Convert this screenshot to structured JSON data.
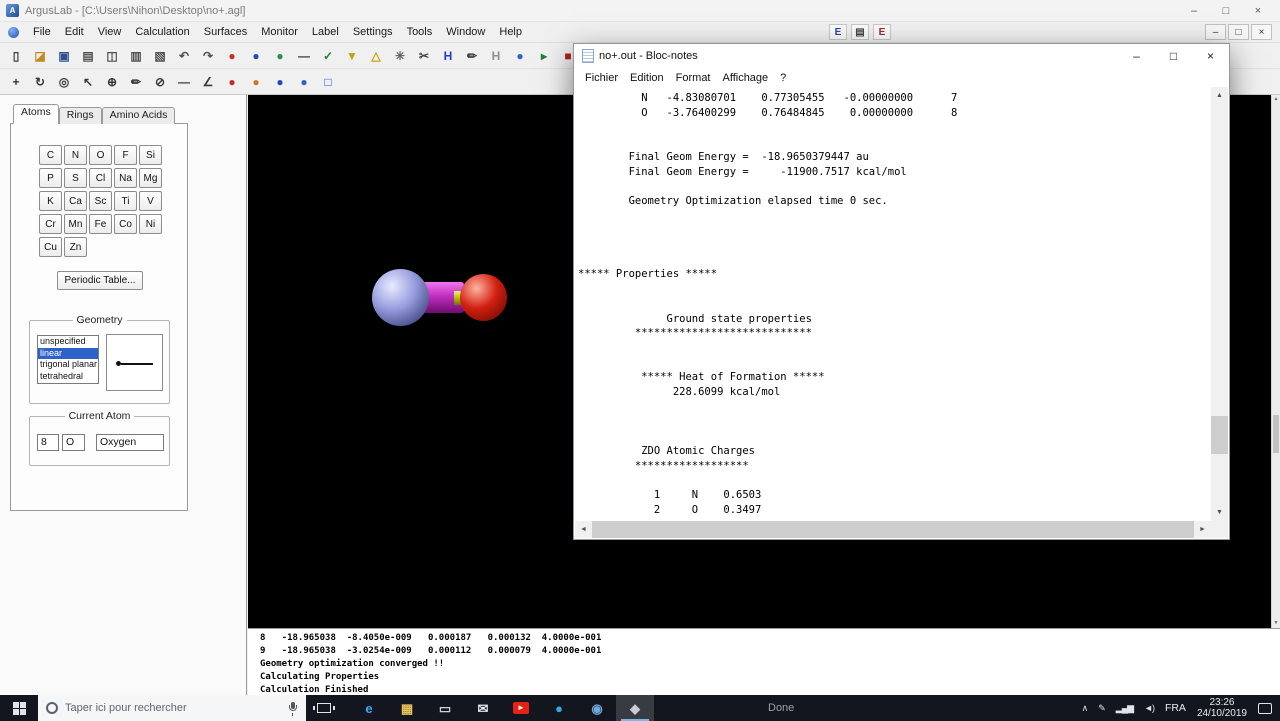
{
  "colors": {
    "selection": "#2f62c8",
    "taskbar-bg": "#14161f",
    "accent-underline": "#79b7e8",
    "mol-n": "#989ede",
    "mol-bond": "#c22ec2",
    "mol-bond2": "#c2c20e",
    "mol-o": "#d22010"
  },
  "arguslab": {
    "title": "ArgusLab - [C:\\Users\\Nihon\\Desktop\\no+.agl]",
    "app_icon_letter": "A",
    "window_controls": [
      {
        "name": "arguslab-minimize-button",
        "glyph": "–"
      },
      {
        "name": "arguslab-maximize-button",
        "glyph": "□"
      },
      {
        "name": "arguslab-close-button",
        "glyph": "×"
      }
    ],
    "menu": [
      "File",
      "Edit",
      "View",
      "Calculation",
      "Surfaces",
      "Monitor",
      "Label",
      "Settings",
      "Tools",
      "Window",
      "Help"
    ],
    "menubar_tools": [
      {
        "name": "energy-icon",
        "glyph": "E",
        "color": "#2a4a9a"
      },
      {
        "name": "output-table-icon",
        "glyph": "▤",
        "color": "#444444"
      },
      {
        "name": "energy-plot-icon",
        "glyph": "E",
        "color": "#9a2a2a"
      }
    ],
    "mdi_controls": [
      {
        "name": "mdi-minimize-button",
        "glyph": "–"
      },
      {
        "name": "mdi-restore-button",
        "glyph": "□"
      },
      {
        "name": "mdi-close-button",
        "glyph": "×"
      }
    ],
    "toolbar_main": [
      {
        "name": "new-file-icon",
        "glyph": "▯",
        "color": "#404040"
      },
      {
        "name": "open-folder-icon",
        "glyph": "◪",
        "color": "#c08a28"
      },
      {
        "name": "save-icon",
        "glyph": "▣",
        "color": "#30508c"
      },
      {
        "name": "print-icon",
        "glyph": "▤",
        "color": "#505050"
      },
      {
        "name": "capture-icon",
        "glyph": "◫",
        "color": "#505050"
      },
      {
        "name": "copy-icon",
        "glyph": "▥",
        "color": "#505050"
      },
      {
        "name": "paste-icon",
        "glyph": "▧",
        "color": "#505050"
      },
      {
        "name": "undo-icon",
        "glyph": "↶",
        "color": "#505050"
      },
      {
        "name": "redo-icon",
        "glyph": "↷",
        "color": "#505050"
      },
      {
        "name": "atom-red-icon",
        "glyph": "●",
        "color": "#c03028"
      },
      {
        "name": "atom-blue-icon",
        "glyph": "●",
        "color": "#2848b8"
      },
      {
        "name": "atom-green-icon",
        "glyph": "●",
        "color": "#289048"
      },
      {
        "name": "bond-tool-icon",
        "glyph": "―",
        "color": "#303030"
      },
      {
        "name": "clean-geometry-icon",
        "glyph": "✓",
        "color": "#208030"
      },
      {
        "name": "minimize-energy-icon",
        "glyph": "▼",
        "color": "#c8a000"
      },
      {
        "name": "measure-tool-icon",
        "glyph": "△",
        "color": "#c8a000"
      },
      {
        "name": "settings-gear-icon",
        "glyph": "✳",
        "color": "#606060"
      },
      {
        "name": "scissors-icon",
        "glyph": "✂",
        "color": "#404040"
      },
      {
        "name": "add-hydrogens-icon",
        "glyph": "H",
        "color": "#2040c0"
      },
      {
        "name": "pencil-icon",
        "glyph": "✏",
        "color": "#404040"
      },
      {
        "name": "remove-hydrogens-icon",
        "glyph": "H",
        "color": "#909090"
      },
      {
        "name": "sphere-display-icon",
        "glyph": "●",
        "color": "#3060d0"
      },
      {
        "name": "run-calculation-icon",
        "glyph": "▸",
        "color": "#208030"
      },
      {
        "name": "stop-calculation-icon",
        "glyph": "■",
        "color": "#b02020"
      }
    ],
    "toolbar_tools": [
      {
        "name": "pan-tool-icon",
        "glyph": "+",
        "color": "#383838"
      },
      {
        "name": "rotate-tool-icon",
        "glyph": "↻",
        "color": "#383838"
      },
      {
        "name": "zoom-tool-icon",
        "glyph": "◎",
        "color": "#383838"
      },
      {
        "name": "select-tool-icon",
        "glyph": "↖",
        "color": "#383838"
      },
      {
        "name": "center-tool-icon",
        "glyph": "⊕",
        "color": "#383838"
      },
      {
        "name": "draw-tool-icon",
        "glyph": "✏",
        "color": "#383838"
      },
      {
        "name": "erase-tool-icon",
        "glyph": "⊘",
        "color": "#383838"
      },
      {
        "name": "bond-line-icon",
        "glyph": "―",
        "color": "#383838"
      },
      {
        "name": "angle-tool-icon",
        "glyph": "∠",
        "color": "#383838"
      },
      {
        "name": "atom-color-red-icon",
        "glyph": "●",
        "color": "#c03028"
      },
      {
        "name": "atom-color-orange-icon",
        "glyph": "●",
        "color": "#d07820"
      },
      {
        "name": "atom-color-blue-icon",
        "glyph": "●",
        "color": "#2848b8"
      },
      {
        "name": "atom-color-navy-icon",
        "glyph": "●",
        "color": "#3060d0"
      },
      {
        "name": "selection-box-icon",
        "glyph": "□",
        "color": "#2858c8"
      }
    ],
    "left_panel": {
      "tabs": [
        {
          "label": "Atoms",
          "selected": true
        },
        {
          "label": "Rings"
        },
        {
          "label": "Amino Acids"
        }
      ],
      "elements": [
        "C",
        "N",
        "O",
        "F",
        "Si",
        "P",
        "S",
        "Cl",
        "Na",
        "Mg",
        "K",
        "Ca",
        "Sc",
        "Ti",
        "V",
        "Cr",
        "Mn",
        "Fe",
        "Co",
        "Ni",
        "Cu",
        "Zn"
      ],
      "periodic_table_label": "Periodic Table...",
      "geometry": {
        "label": "Geometry",
        "options": [
          {
            "label": "unspecified"
          },
          {
            "label": "linear",
            "selected": true
          },
          {
            "label": "trigonal planar"
          },
          {
            "label": "tetrahedral"
          }
        ]
      },
      "current_atom": {
        "label": "Current Atom",
        "atomic_number": "8",
        "symbol": "O",
        "element_name": "Oxygen"
      }
    },
    "scrollbar": {
      "up": "▲",
      "down": "▼"
    },
    "log_lines": [
      "8   -18.965038  -8.4050e-009   0.000187   0.000132  4.0000e-001",
      "9   -18.965038  -3.0254e-009   0.000112   0.000079  4.0000e-001",
      "Geometry optimization converged !!",
      "Calculating Properties",
      "Calculation Finished"
    ]
  },
  "notepad": {
    "title": "no+.out - Bloc-notes",
    "window_controls": [
      {
        "name": "notepad-minimize-button",
        "glyph": "–"
      },
      {
        "name": "notepad-maximize-button",
        "glyph": "□"
      },
      {
        "name": "notepad-close-button",
        "glyph": "×"
      }
    ],
    "menu": [
      "Fichier",
      "Edition",
      "Format",
      "Affichage",
      "?"
    ],
    "content_lines": [
      "          N   -4.83080701    0.77305455   -0.00000000      7",
      "          O   -3.76400299    0.76484845    0.00000000      8",
      "",
      "",
      "        Final Geom Energy =  -18.9650379447 au",
      "        Final Geom Energy =     -11900.7517 kcal/mol",
      "",
      "        Geometry Optimization elapsed time 0 sec.",
      "",
      "",
      "",
      "",
      "***** Properties *****",
      "",
      "",
      "              Ground state properties",
      "         ****************************",
      "",
      "",
      "          ***** Heat of Formation *****",
      "               228.6099 kcal/mol",
      "",
      "",
      "",
      "          ZDO Atomic Charges",
      "         ******************",
      "",
      "            1     N    0.6503",
      "            2     O    0.3497"
    ],
    "scrollbar": {
      "up": "▲",
      "down": "▼",
      "left": "◄",
      "right": "►"
    }
  },
  "taskbar": {
    "search_placeholder": "Taper ici pour rechercher",
    "status_text": "Done",
    "apps": [
      {
        "name": "edge-icon",
        "glyph": "e",
        "color": "#3fa9f5"
      },
      {
        "name": "file-explorer-icon",
        "glyph": "▦",
        "color": "#e8c25a"
      },
      {
        "name": "store-icon",
        "glyph": "▭",
        "color": "#cdd3da"
      },
      {
        "name": "mail-icon",
        "glyph": "✉",
        "color": "#e4e7ec"
      },
      {
        "name": "youtube-icon",
        "glyph": "►",
        "color": "#ffffff",
        "bg": "#e62117"
      },
      {
        "name": "telegram-icon",
        "glyph": "●",
        "color": "#2fa8e0"
      },
      {
        "name": "chrome-icon",
        "glyph": "◉",
        "color": "#6fa8dc"
      },
      {
        "name": "arguslab-taskbar-icon",
        "glyph": "◆",
        "color": "#c8ccd4",
        "active": true
      }
    ],
    "tray_icons": [
      {
        "name": "hidden-icons-chevron",
        "glyph": "∧"
      },
      {
        "name": "ink-pen-icon",
        "glyph": "✎"
      },
      {
        "name": "network-icon",
        "glyph": "▂▄▆"
      },
      {
        "name": "volume-icon",
        "glyph": "◄)"
      }
    ],
    "language": "FRA",
    "time": "23:26",
    "date": "24/10/2019"
  }
}
